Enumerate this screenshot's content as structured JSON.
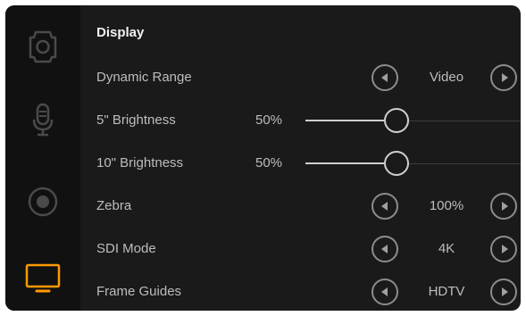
{
  "sidebar": {
    "items": [
      {
        "icon": "camera-icon",
        "active": false
      },
      {
        "icon": "microphone-icon",
        "active": false
      },
      {
        "icon": "record-icon",
        "active": false
      },
      {
        "icon": "monitor-icon",
        "active": true
      }
    ],
    "accent_color": "#ff9a00"
  },
  "panel": {
    "title": "Display",
    "dynamic_range": {
      "label": "Dynamic Range",
      "value": "Video"
    },
    "brightness_5": {
      "label": "5\" Brightness",
      "value_text": "50%",
      "level": 0.5
    },
    "brightness_10": {
      "label": "10\" Brightness",
      "value_text": "50%",
      "level": 0.5
    },
    "zebra": {
      "label": "Zebra",
      "value": "100%"
    },
    "sdi_mode": {
      "label": "SDI Mode",
      "value": "4K"
    },
    "frame_guides": {
      "label": "Frame Guides",
      "value": "HDTV"
    }
  }
}
